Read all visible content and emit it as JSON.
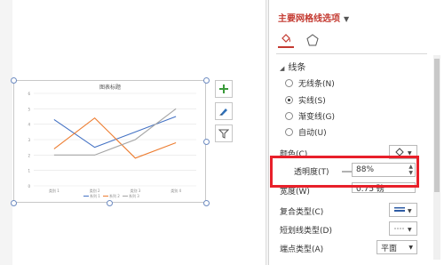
{
  "pane": {
    "title": "主要网格线选项",
    "section": "线条",
    "line_options": [
      {
        "label": "无线条(N)",
        "selected": false
      },
      {
        "label": "实线(S)",
        "selected": true
      },
      {
        "label": "渐变线(G)",
        "selected": false
      },
      {
        "label": "自动(U)",
        "selected": false
      }
    ],
    "props": {
      "color_label": "颜色(C)",
      "transparency_label": "透明度(T)",
      "transparency_value": "88%",
      "width_label": "宽度(W)",
      "width_value": "0.75 磅",
      "compound_label": "复合类型(C)",
      "dash_label": "短划线类型(D)",
      "cap_label": "端点类型(A)",
      "cap_value": "平面"
    }
  },
  "chart_data": {
    "type": "line",
    "title": "图表标题",
    "categories": [
      "类别 1",
      "类别 2",
      "类别 3",
      "类别 4"
    ],
    "series": [
      {
        "name": "系列 1",
        "values": [
          4.3,
          2.5,
          3.5,
          4.5
        ],
        "color": "#4472c4"
      },
      {
        "name": "系列 2",
        "values": [
          2.4,
          4.4,
          1.8,
          2.8
        ],
        "color": "#ed7d31"
      },
      {
        "name": "系列 3",
        "values": [
          2.0,
          2.0,
          3.0,
          5.0
        ],
        "color": "#a5a5a5"
      }
    ],
    "ylim": [
      0,
      6
    ],
    "yticks": [
      "6",
      "5",
      "4",
      "3",
      "2",
      "1",
      "0"
    ],
    "grid": true,
    "legend": "bottom"
  },
  "colors": {
    "accent": "#c43a31",
    "highlight": "#e8202a"
  }
}
